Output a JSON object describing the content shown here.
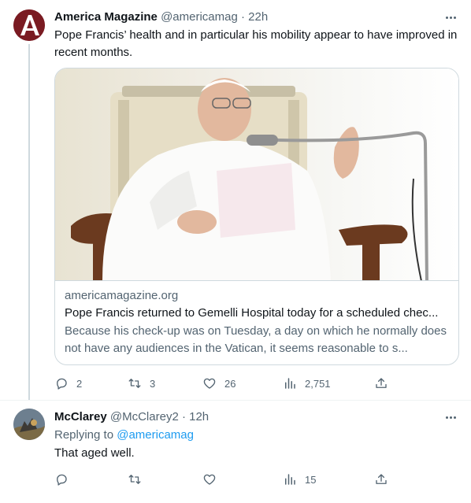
{
  "tweets": [
    {
      "display_name": "America Magazine",
      "handle": "@americamag",
      "time": "22h",
      "meta": "@americamag · 22h",
      "text": "Pope Francis’ health and in particular his mobility appear to have improved in recent months.",
      "avatar_letter": "A",
      "card": {
        "domain": "americamagazine.org",
        "title": "Pope Francis returned to Gemelli Hospital today for a scheduled chec...",
        "description": "Because his check-up was on Tuesday, a day on which he normally does not have any audiences in the Vatican, it seems reasonable to s..."
      },
      "stats": {
        "replies": "2",
        "retweets": "3",
        "likes": "26",
        "views": "2,751"
      }
    },
    {
      "display_name": "McClarey",
      "handle": "@McClarey2",
      "time": "12h",
      "meta": "@McClarey2 · 12h",
      "replying_prefix": "Replying to",
      "replying_to": "@americamag",
      "text": "That aged well.",
      "stats": {
        "replies": "",
        "retweets": "",
        "likes": "",
        "views": "15"
      }
    }
  ],
  "icons": [
    "reply-icon",
    "retweet-icon",
    "like-icon",
    "views-icon",
    "share-icon",
    "more-icon"
  ],
  "colors": {
    "link": "#1d9bf0",
    "secondary_text": "#536471",
    "border": "#cfd9de",
    "avatar_am": "#7a1b22"
  }
}
